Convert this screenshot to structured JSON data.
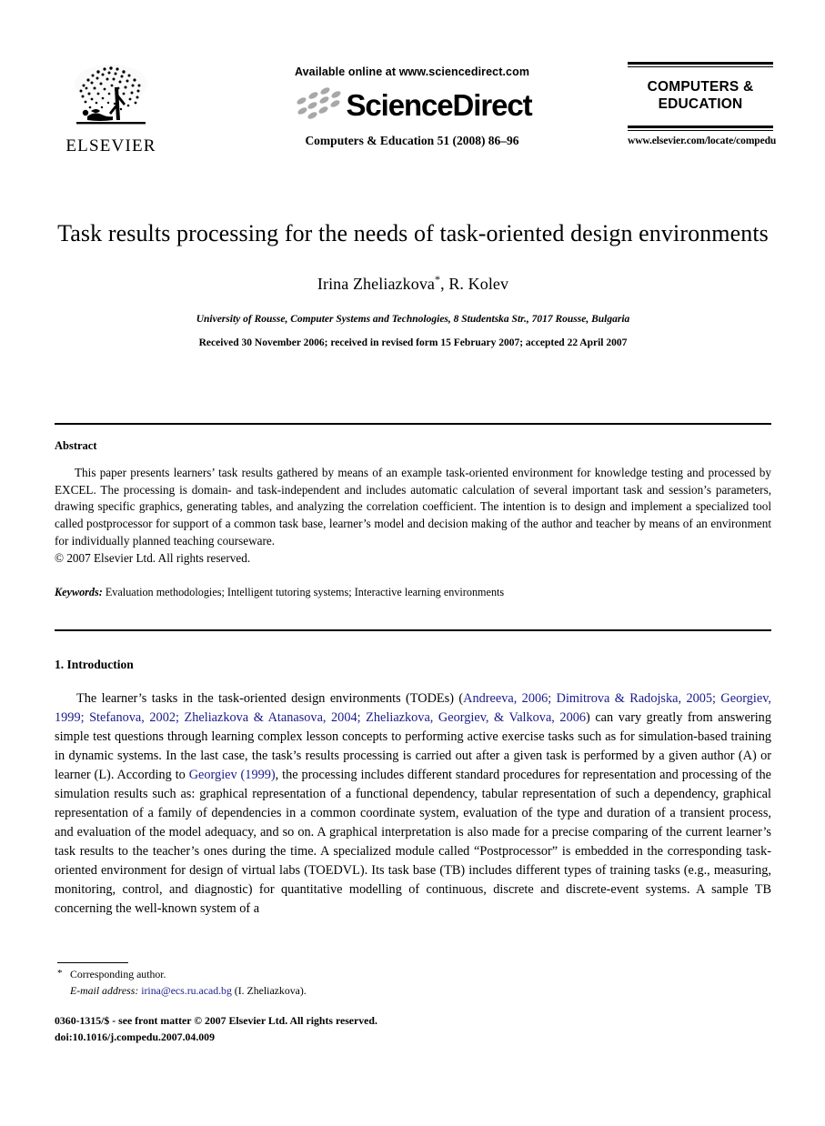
{
  "header": {
    "publisher_logo_alt": "ELSEVIER",
    "publisher_name": "ELSEVIER",
    "available_online": "Available online at www.sciencedirect.com",
    "sciencedirect_wordmark": "ScienceDirect",
    "journal_citation": "Computers & Education 51 (2008) 86–96",
    "journal_name_line1": "COMPUTERS &",
    "journal_name_line2": "EDUCATION",
    "journal_url": "www.elsevier.com/locate/compedu"
  },
  "article": {
    "title": "Task results processing for the needs of task-oriented design environments",
    "authors": "Irina Zheliazkova",
    "author_marker": "*",
    "authors_rest": ", R. Kolev",
    "affiliation": "University of Rousse, Computer Systems and Technologies, 8 Studentska Str., 7017 Rousse, Bulgaria",
    "received": "Received 30 November 2006; received in revised form 15 February 2007; accepted 22 April 2007"
  },
  "abstract": {
    "heading": "Abstract",
    "text": "This paper presents learners’ task results gathered by means of an example task-oriented environment for knowledge testing and processed by EXCEL. The processing is domain- and task-independent and includes automatic calculation of several important task and session’s parameters, drawing specific graphics, generating tables, and analyzing the correlation coefficient. The intention is to design and implement a specialized tool called postprocessor for support of a common task base, learner’s model and decision making of the author and teacher by means of an environment for individually planned teaching courseware.",
    "copyright": "© 2007 Elsevier Ltd. All rights reserved.",
    "keywords_label": "Keywords:",
    "keywords_value": "Evaluation methodologies; Intelligent tutoring systems; Interactive learning environments"
  },
  "introduction": {
    "heading": "1. Introduction",
    "p1_part1": "The learner’s tasks in the task-oriented design environments (TODEs) (",
    "p1_citations_1": "Andreeva, 2006; Dimitrova & Radojska, 2005; Georgiev, 1999; Stefanova, 2002; Zheliazkova & Atanasova, 2004; Zheliazkova, Georgiev, & Valkova, 2006",
    "p1_part2": ") can vary greatly from answering simple test questions through learning complex lesson concepts to performing active exercise tasks such as for simulation-based training in dynamic systems. In the last case, the task’s results processing is carried out after a given task is performed by a given author (A) or learner (L). According to ",
    "p1_citation_2": "Georgiev (1999)",
    "p1_part3": ", the processing includes different standard procedures for representation and processing of the simulation results such as: graphical representation of a functional dependency, tabular representation of such a dependency, graphical representation of a family of dependencies in a common coordinate system, evaluation of the type and duration of a transient process, and evaluation of the model adequacy, and so on. A graphical interpretation is also made for a precise comparing of the current learner’s task results to the teacher’s ones during the time. A specialized module called “Postprocessor” is embedded in the corresponding task-oriented environment for design of virtual labs (TOEDVL). Its task base (TB) includes different types of training tasks (e.g., measuring, monitoring, control, and diagnostic) for quantitative modelling of continuous, discrete and discrete-event systems. A sample TB concerning the well-known system of a"
  },
  "footnote": {
    "marker": "*",
    "corresponding": "Corresponding author.",
    "email_label": "E-mail address:",
    "email": "irina@ecs.ru.acad.bg",
    "email_owner": "(I. Zheliazkova)."
  },
  "footer": {
    "issn_line": "0360-1315/$ - see front matter © 2007 Elsevier Ltd. All rights reserved.",
    "doi_line": "doi:10.1016/j.compedu.2007.04.009"
  },
  "colors": {
    "link": "#1a1a8c",
    "text": "#000000",
    "logo_gray": "#a8a8a8"
  }
}
